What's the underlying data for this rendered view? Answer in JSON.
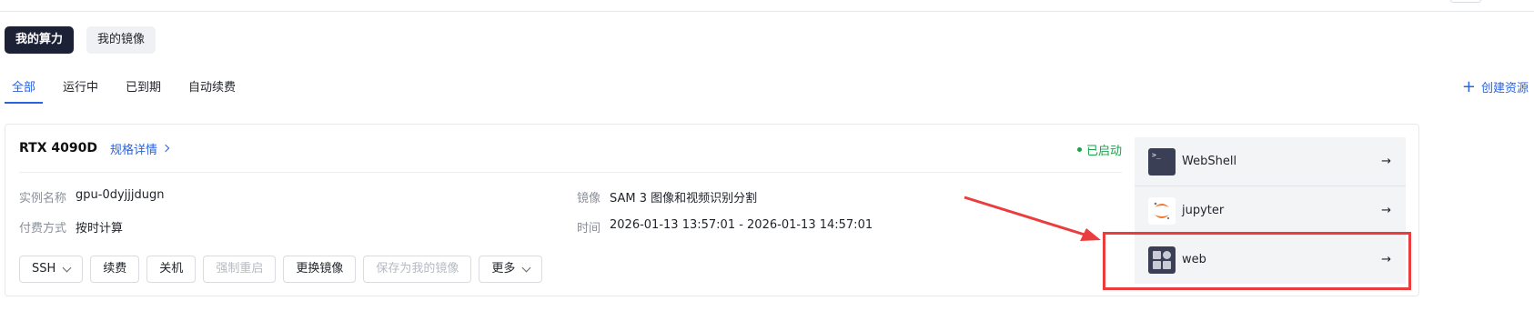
{
  "segments": {
    "compute": "我的算力",
    "images": "我的镜像"
  },
  "tabs": [
    "全部",
    "运行中",
    "已到期",
    "自动续费"
  ],
  "create_label": "创建资源",
  "instance": {
    "gpu": "RTX 4090D",
    "spec_link": "规格详情",
    "status": "已启动",
    "fields": {
      "name_label": "实例名称",
      "name_value": "gpu-0dyjjjdugn",
      "billing_label": "付费方式",
      "billing_value": "按时计算",
      "image_label": "镜像",
      "image_value": "SAM 3 图像和视频识别分割",
      "time_label": "时间",
      "time_value": "2026-01-13 13:57:01 - 2026-01-13 14:57:01"
    },
    "actions": {
      "ssh": "SSH",
      "renew": "续费",
      "shutdown": "关机",
      "force_restart": "强制重启",
      "change_image": "更换镜像",
      "save_image": "保存为我的镜像",
      "more": "更多"
    },
    "quick_access": [
      {
        "label": "WebShell",
        "icon": "terminal-icon"
      },
      {
        "label": "jupyter",
        "icon": "jupyter-icon"
      },
      {
        "label": "web",
        "icon": "web-app-icon"
      }
    ],
    "status_color": "#1aa34a"
  },
  "accent_color": "#2a62e0",
  "highlight_color": "#ea3d3d"
}
